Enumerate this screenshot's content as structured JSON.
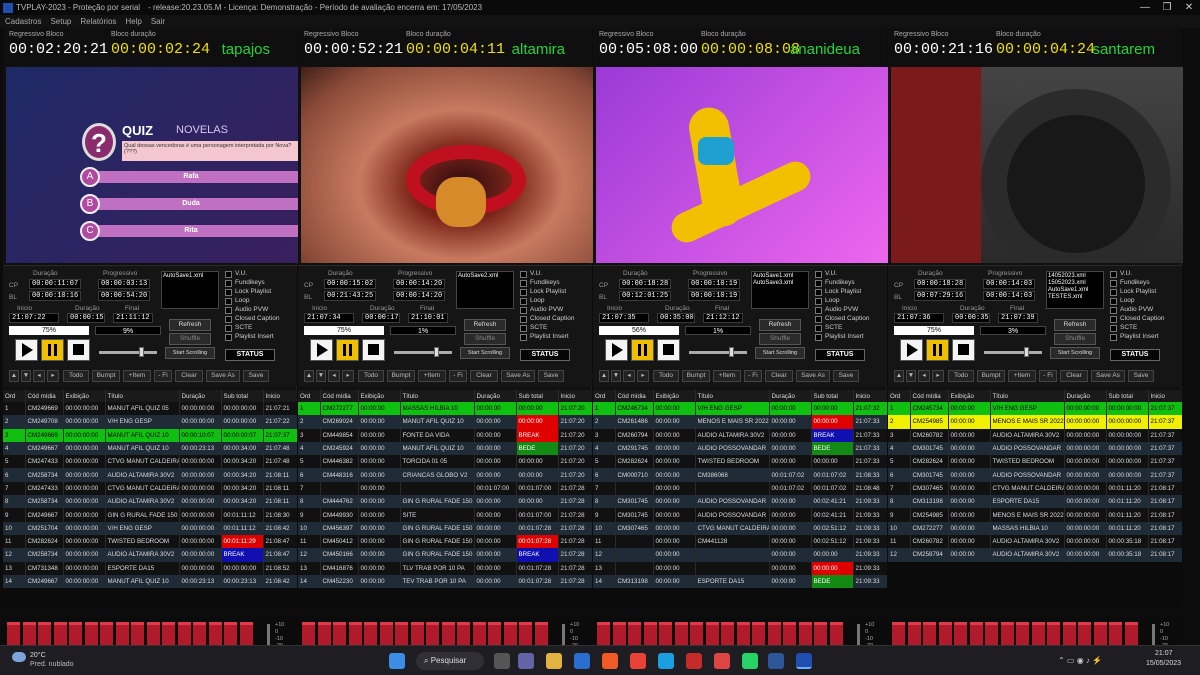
{
  "app": {
    "title": "TVPLAY-2023 - Proteção por serial",
    "release": "- release:20.23.05.M - Licença: Demonstração - Período de avaliação encerra em: 17/05/2023",
    "min": "—",
    "max": "❐",
    "close": "✕"
  },
  "menu": [
    "Cadastros",
    "Setup",
    "Relatórios",
    "Help",
    "Sair"
  ],
  "labels": {
    "regressivo_bloco": "Regressivo Bloco",
    "bloco_duracao": "Bloco duração",
    "duracao": "Duração",
    "progressivo": "Progressivo",
    "inicio": "Inicio",
    "final": "Final",
    "cp": "CP",
    "bl": "BL",
    "refresh": "Refresh",
    "shuffle": "Shuffle",
    "start_scrolling": "Start Scrolling",
    "status": "STATUS"
  },
  "checks": [
    "V.U.",
    "Fundikeys",
    "Lock Playlist",
    "Loop",
    "Audio PVW",
    "Closed Caption",
    "SCTE",
    "Playlist Insert"
  ],
  "toolbar": [
    "Todo",
    "Bumpt",
    "+Item",
    "- Fi",
    "Clear",
    "Save As",
    "Save"
  ],
  "headers": [
    "Ord",
    "Cód mídia",
    "Exibição",
    "Título",
    "Duração",
    "Sub total",
    "Inicio"
  ],
  "vu_scale": [
    "+10",
    "0",
    "-10",
    "-20",
    "-30",
    "-40",
    "-50"
  ],
  "vu_channels": [
    "1",
    "2",
    "3",
    "4",
    "5",
    "6",
    "7",
    "8",
    "9",
    "10",
    "11",
    "12",
    "13",
    "14",
    "15",
    "16"
  ],
  "panels": [
    {
      "name": "tapajos",
      "regress": "00:02:20:21",
      "bloco": "00:00:02:24",
      "cp_dur": "00:00:11:07",
      "bl_dur": "00:00:10:16",
      "cp_prog": "00:00:03:13",
      "bl_prog": "00:00:54:20",
      "inicio": "21:07:22",
      "dur": "00:00:15",
      "final": "21:11:12",
      "pct1": "75%",
      "pct2": "9%",
      "file": "AutoSave1.xml",
      "video_title": "QUIZ",
      "video_sub": "NOVELAS",
      "video_q": "Qual dessas vencedoras é uma personagem interpretada por Nova? (???)",
      "options": [
        "Rafa",
        "Duda",
        "Rita"
      ],
      "rows": [
        [
          "1",
          "CM249669",
          "00:00:00:00",
          "MANUT AFIL QUIZ 05",
          "00:00:00:00",
          "00:00:00:00",
          "21:07:21"
        ],
        [
          "2",
          "CM249708",
          "00:00:00:00",
          "V/H ENG GESP",
          "00:00:00:00",
          "00:00:00:00",
          "21:07:22"
        ],
        [
          "3",
          "CM249669",
          "00:00:00:00",
          "MANUT AFIL QUIZ 10",
          "00:00:10:07",
          "00:00:00:07",
          "21:07:37"
        ],
        [
          "4",
          "CM249667",
          "00:00:00:00",
          "MANUT AFIL QUIZ 10",
          "00:00:23:13",
          "00:00:34:00",
          "21:07:48"
        ],
        [
          "5",
          "CM247433",
          "00:00:00:00",
          "CTVG MANUT CALDEIRA",
          "00:00:00:00",
          "00:00:34:20",
          "21:07:48"
        ],
        [
          "6",
          "CM258734",
          "00:00:00:00",
          "AUDIO ALTAMIRA 30V2",
          "00:00:00:00",
          "00:00:34:20",
          "21:08:11"
        ],
        [
          "7",
          "CM247433",
          "00:00:00:00",
          "CTVG MANUT CALDEIRA",
          "00:00:00:00",
          "00:00:34:20",
          "21:08:11"
        ],
        [
          "8",
          "CM258734",
          "00:00:00:00",
          "AUDIO ALTAMIRA 30V2",
          "00:00:00:00",
          "00:00:34:20",
          "21:08:11"
        ],
        [
          "9",
          "CM249667",
          "00:00:00:00",
          "GIN G RURAL FADE 150",
          "00:00:00:00",
          "00:01:11:12",
          "21:08:30"
        ],
        [
          "10",
          "CM251704",
          "00:00:00:00",
          "V/H ENG GESP",
          "00:00:00:00",
          "00:01:11:12",
          "21:08:42"
        ],
        [
          "11",
          "CM282624",
          "00:00:00:00",
          "TWISTED BEDROOM",
          "00:00:00:00",
          "00:01:11:29",
          "21:08:47"
        ],
        [
          "12",
          "CM258734",
          "00:00:00:00",
          "AUDIO ALTAMIRA 30V2",
          "00:00:00:00",
          "BREAK",
          "21:08:47"
        ],
        [
          "13",
          "CM731348",
          "00:00:00:00",
          "ESPORTE DA15",
          "00:00:00:00",
          "00:00:00:00",
          "21:08:52"
        ],
        [
          "14",
          "CM249667",
          "00:00:00:00",
          "MANUT AFIL QUIZ 10",
          "00:00:23:13",
          "00:00:23:13",
          "21:08:42"
        ]
      ]
    },
    {
      "name": "altamira",
      "regress": "00:00:52:21",
      "bloco": "00:00:04:11",
      "cp_dur": "00:00:15:02",
      "bl_dur": "00:21:43:25",
      "cp_prog": "00:00:14:20",
      "bl_prog": "00:00:14:20",
      "inicio": "21:07:34",
      "dur": "00:00:17",
      "final": "21:10:01",
      "pct1": "75%",
      "pct2": "1%",
      "file": "AutoSave2.xml",
      "rows": [
        [
          "1",
          "CM272277",
          "00:00:00",
          "MASSAS HILBIA 10",
          "00:00:00",
          "00:00:00",
          "21:07:20"
        ],
        [
          "2",
          "CM269024",
          "00:00:00",
          "MANUT AFIL QUIZ 10",
          "00:00:00",
          "00:00:00",
          "21:07:20"
        ],
        [
          "3",
          "CM449854",
          "00:00:00",
          "FONTE DA VIDA",
          "00:00:00",
          "BREAK",
          "21:07:20"
        ],
        [
          "4",
          "CM245924",
          "00:00:00",
          "MANUT AFIL QUIZ 10",
          "00:00:00",
          "BEDE",
          "21:07:20"
        ],
        [
          "5",
          "CM446382",
          "00:00:00",
          "TORCIDA 01 05",
          "00:00:00",
          "00:00:00",
          "21:07:20"
        ],
        [
          "6",
          "CM448316",
          "00:00:00",
          "CRIANCAS GLOBO V2",
          "00:00:00",
          "00:00:00",
          "21:07:20"
        ],
        [
          "7",
          "",
          "00:00:00",
          "",
          "00:01:07:00",
          "00:01:07:00",
          "21:07:28"
        ],
        [
          "8",
          "CM444762",
          "00:00:00",
          "GIN G RURAL FADE 150",
          "00:00:00",
          "00:00:00",
          "21:07:28"
        ],
        [
          "9",
          "CM449930",
          "00:00:00",
          "SITE",
          "00:00:00",
          "00:01:07:00",
          "21:07:28"
        ],
        [
          "10",
          "CM456397",
          "00:00:00",
          "GIN G RURAL FADE 150",
          "00:00:00",
          "00:01:07:28",
          "21:07:28"
        ],
        [
          "11",
          "CM450412",
          "00:00:00",
          "GIN G RURAL FADE 150",
          "00:00:00",
          "00:01:07:28",
          "21:07:28"
        ],
        [
          "12",
          "CM450166",
          "00:00:00",
          "GIN G RURAL FADE 150",
          "00:00:00",
          "BREAK",
          "21:07:28"
        ],
        [
          "13",
          "CM416876",
          "00:00:00",
          "TLV TRAB POR 10 PA",
          "00:00:00",
          "00:01:07:28",
          "21:07:28"
        ],
        [
          "14",
          "CM452230",
          "00:00:00",
          "TEV TRAB POR 10 PA",
          "00:00:00",
          "00:01:07:28",
          "21:07:28"
        ]
      ]
    },
    {
      "name": "ananideua",
      "regress": "00:05:08:00",
      "bloco": "00:00:08:08",
      "cp_dur": "00:00:18:28",
      "bl_dur": "00:12:01:25",
      "cp_prog": "00:00:10:19",
      "bl_prog": "00:00:10:19",
      "inicio": "21:07:35",
      "dur": "00:35:00",
      "final": "21:12:12",
      "pct1": "56%",
      "pct2": "1%",
      "file": "AutoSave1.xml AutoSave3.xml",
      "rows": [
        [
          "1",
          "CM246734",
          "00:00:00",
          "V/H ENG GESP",
          "00:00:00",
          "00:00:00",
          "21:07:32"
        ],
        [
          "2",
          "CM261486",
          "00:00:00",
          "MENOS E MAIS SR 2022",
          "00:00:00",
          "00:00:00",
          "21:07:33"
        ],
        [
          "3",
          "CM260794",
          "00:00:00",
          "AUDIO ALTAMIRA 30V2",
          "00:00:00",
          "BREAK",
          "21:07:33"
        ],
        [
          "4",
          "CM291745",
          "00:00:00",
          "AUDIO POSSOVANDAR",
          "00:00:00",
          "BEDE",
          "21:07:33"
        ],
        [
          "5",
          "CM282624",
          "00:00:00",
          "TWISTED BEDROOM",
          "00:00:00",
          "00:00:00",
          "21:07:33"
        ],
        [
          "6",
          "CM000710",
          "00:00:00",
          "CM386068",
          "00:01:07:02",
          "00:01:07:02",
          "21:08:33"
        ],
        [
          "7",
          "",
          "00:00:00",
          "",
          "00:01:07:02",
          "00:01:07:02",
          "21:08:48"
        ],
        [
          "8",
          "CM301745",
          "00:00:00",
          "AUDIO POSSOVANDAR",
          "00:00:00",
          "00:02:41:21",
          "21:09:33"
        ],
        [
          "9",
          "CM301745",
          "00:00:00",
          "AUDIO POSSOVANDAR",
          "00:00:00",
          "00:02:41:21",
          "21:09:33"
        ],
        [
          "10",
          "CM307465",
          "00:00:00",
          "CTVG MANUT CALDEIRA",
          "00:00:00",
          "00:02:51:12",
          "21:09:33"
        ],
        [
          "11",
          "",
          "00:00:00",
          "CM441128",
          "00:00:00",
          "00:02:51:12",
          "21:09:33"
        ],
        [
          "12",
          "",
          "00:00:00",
          "",
          "00:00:00",
          "00:00:00",
          "21:09:33"
        ],
        [
          "13",
          "",
          "00:00:00",
          "",
          "00:00:00",
          "00:00:00",
          "21:09:33"
        ],
        [
          "14",
          "CM313198",
          "00:00:00",
          "ESPORTE DA15",
          "00:00:00",
          "BEDE",
          "21:09:33"
        ]
      ]
    },
    {
      "name": "santarem",
      "regress": "00:00:21:16",
      "bloco": "00:00:04:24",
      "cp_dur": "00:00:18:28",
      "bl_dur": "00:07:29:16",
      "cp_prog": "00:00:14:03",
      "bl_prog": "00:00:14:03",
      "inicio": "21:07:36",
      "dur": "00:00:35",
      "final": "21:07:39",
      "pct1": "75%",
      "pct2": "3%",
      "file": "14052023.xml 15052023.xml AutoSave1.xml TESTES.xml",
      "rows": [
        [
          "1",
          "CM245734",
          "00:00:00",
          "V/H ENG GESP",
          "00:00:00:00",
          "00:00:00:00",
          "21:07:37"
        ],
        [
          "2",
          "CM254985",
          "00:00:00",
          "MENOS E MAIS SR 2022",
          "00:00:00:00",
          "00:00:00:00",
          "21:07:37"
        ],
        [
          "3",
          "CM260782",
          "00:00:00",
          "AUDIO ALTAMIRA 30V2",
          "00:00:00:00",
          "00:00:00:00",
          "21:07:37"
        ],
        [
          "4",
          "CM301745",
          "00:00:00",
          "AUDIO POSSOVANDAR",
          "00:00:00:00",
          "00:00:00:00",
          "21:07:37"
        ],
        [
          "5",
          "CM282624",
          "00:00:00",
          "TWISTED BEDROOM",
          "00:00:00:00",
          "00:00:00:00",
          "21:07:37"
        ],
        [
          "6",
          "CM301745",
          "00:00:00",
          "AUDIO POSSOVANDAR",
          "00:00:00:00",
          "00:00:00:00",
          "21:07:37"
        ],
        [
          "7",
          "CM307465",
          "00:00:00",
          "CTVG MANUT CALDEIRA",
          "00:00:00:00",
          "00:01:11:20",
          "21:08:17"
        ],
        [
          "8",
          "CM313198",
          "00:00:00",
          "ESPORTE DA15",
          "00:00:00:00",
          "00:01:11:20",
          "21:08:17"
        ],
        [
          "9",
          "CM254985",
          "00:00:00",
          "MENOS E MAIS SR 2022",
          "00:00:00:00",
          "00:01:11:20",
          "21:08:17"
        ],
        [
          "10",
          "CM272277",
          "00:00:00",
          "MASSAS HILBIA 10",
          "00:00:00:00",
          "00:01:11:20",
          "21:08:17"
        ],
        [
          "11",
          "CM260782",
          "00:00:00",
          "AUDIO ALTAMIRA 30V2",
          "00:00:00:00",
          "00:00:35:18",
          "21:08:17"
        ],
        [
          "12",
          "CM258794",
          "00:00:00",
          "AUDIO ALTAMIRA 30V2",
          "00:00:00:00",
          "00:00:35:18",
          "21:08:17"
        ]
      ]
    }
  ],
  "taskbar": {
    "temp": "20°C",
    "weather": "Pred. nublado",
    "search": "Pesquisar",
    "time": "21:07",
    "date": "15/05/2023"
  }
}
